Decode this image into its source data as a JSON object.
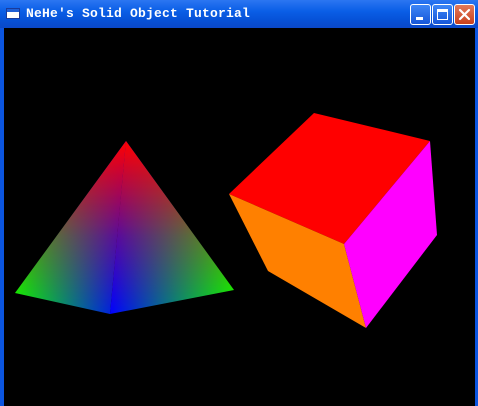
{
  "window": {
    "title": "NeHe's Solid Object Tutorial"
  },
  "titlebar_buttons": {
    "minimize": "minimize-icon",
    "maximize": "maximize-icon",
    "close": "close-icon"
  },
  "scene": {
    "background": "#000000",
    "pyramid": {
      "apex_color": "#ff0000",
      "left_color": "#00ff00",
      "front_color": "#0000ff",
      "right_color": "#00ff00"
    },
    "cube": {
      "top_color": "#ff0000",
      "front_color": "#ff8000",
      "right_color": "#ff00ff"
    }
  }
}
